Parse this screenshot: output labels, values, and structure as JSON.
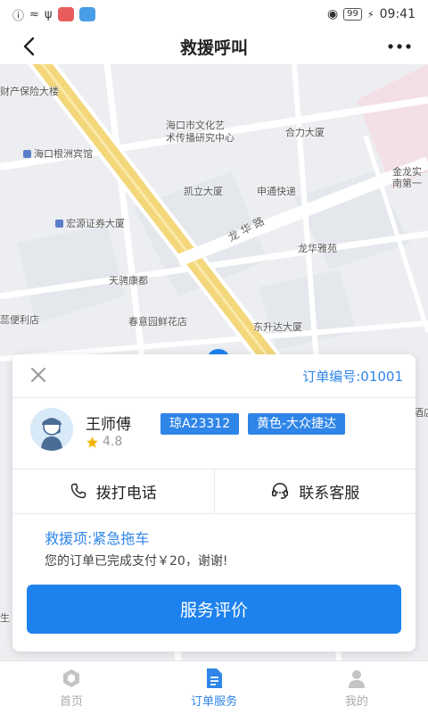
{
  "status_bar": {
    "battery": "99",
    "time": "09:41"
  },
  "nav": {
    "title": "救援呼叫"
  },
  "map": {
    "pois": [
      "财产保险大楼",
      "海口根洲宾馆",
      "海口市文化艺",
      "术传播研究中心",
      "合力大厦",
      "金龙实",
      "南第一",
      "宏源证券大厦",
      "凯立大厦",
      "申通快递",
      "龙华雅苑",
      "天骋康都",
      "春意园鲜花店",
      "东升达大厦",
      "蕊便利店",
      "酒店",
      "生"
    ],
    "road": "龙 华 路"
  },
  "card": {
    "order_no": "订单编号:01001",
    "driver": {
      "name": "王师傅",
      "rating": "4.8"
    },
    "plate": "琼A23312",
    "car": "黄色-大众捷达",
    "call_label": "拨打电话",
    "service_label": "联系客服",
    "rescue_item": "救援项:紧急拖车",
    "paid_msg": "您的订单已完成支付￥20，谢谢!",
    "rate_button": "服务评价"
  },
  "tabs": [
    {
      "label": "首页"
    },
    {
      "label": "订单服务"
    },
    {
      "label": "我的"
    }
  ],
  "colors": {
    "accent": "#2f85e8",
    "button": "#1e82ee",
    "road_yellow": "#f3d77a"
  }
}
